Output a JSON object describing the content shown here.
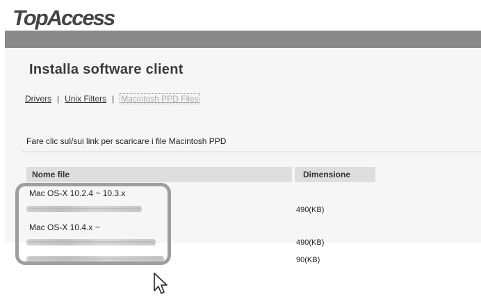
{
  "app": {
    "logo_text": "TopAccess"
  },
  "page": {
    "title": "Installa software client"
  },
  "tabs": [
    {
      "label": "Drivers",
      "active": false
    },
    {
      "label": "Unix Filters",
      "active": false
    },
    {
      "label": "Macintosh PPD Files",
      "active": true
    }
  ],
  "tab_separator": "|",
  "instruction": "Fare clic sul/sui link per scaricare i file Macintosh PPD",
  "table": {
    "headers": {
      "name": "Nome file",
      "size": "Dimensione"
    },
    "groups": [
      {
        "label": "Mac OS-X 10.2.4 ~ 10.3.x",
        "files": [
          {
            "size": "490(KB)"
          }
        ]
      },
      {
        "label": "Mac OS-X 10.4.x ~",
        "files": [
          {
            "size": "490(KB)"
          },
          {
            "size": "90(KB)"
          }
        ]
      }
    ]
  },
  "colors": {
    "header_band": "#8a8a8a",
    "highlight_border": "#9e9e9e"
  },
  "icons": {
    "pointer": "mouse-pointer-icon"
  }
}
